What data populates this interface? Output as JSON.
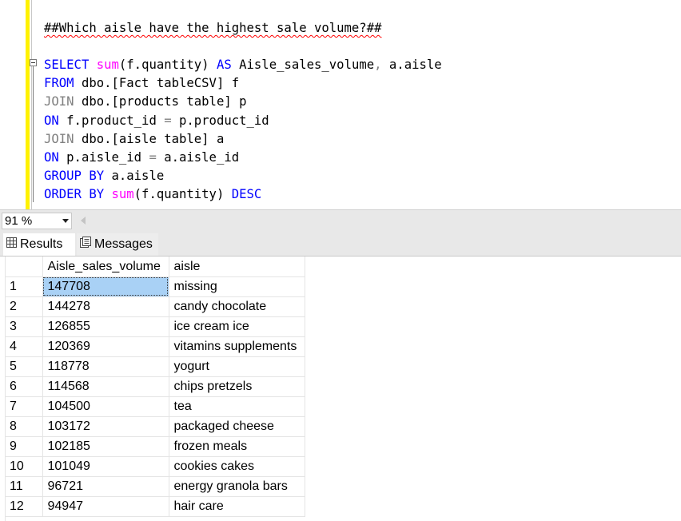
{
  "editor": {
    "comment": "##Which aisle have the highest sale volume?##",
    "lines": [
      {
        "a": "SELECT",
        "b": " ",
        "c": "sum",
        "d": "(f.quantity) ",
        "e": "AS",
        "f": " Aisle_sales_volume",
        "g": ",",
        "h": " a.aisle"
      },
      {
        "a": "FROM",
        "b": " dbo.[Fact tableCSV] f"
      },
      {
        "a": "JOIN",
        "b": " dbo.[products table] p"
      },
      {
        "a": "ON",
        "b": " f.product_id ",
        "c": "=",
        "d": " p.product_id"
      },
      {
        "a": "JOIN",
        "b": " dbo.[aisle table] a"
      },
      {
        "a": "ON",
        "b": " p.aisle_id ",
        "c": "=",
        "d": " a.aisle_id"
      },
      {
        "a": "GROUP BY",
        "b": " a.aisle"
      },
      {
        "a": "ORDER BY",
        "b": " ",
        "c": "sum",
        "d": "(f.quantity) ",
        "e": "DESC"
      }
    ]
  },
  "zoom": {
    "value": "91 %"
  },
  "tabs": {
    "results": "Results",
    "messages": "Messages"
  },
  "grid": {
    "columns": [
      "",
      "Aisle_sales_volume",
      "aisle"
    ],
    "rows": [
      [
        "1",
        "147708",
        "missing"
      ],
      [
        "2",
        "144278",
        "candy chocolate"
      ],
      [
        "3",
        "126855",
        "ice cream ice"
      ],
      [
        "4",
        "120369",
        "vitamins supplements"
      ],
      [
        "5",
        "118778",
        "yogurt"
      ],
      [
        "6",
        "114568",
        "chips pretzels"
      ],
      [
        "7",
        "104500",
        "tea"
      ],
      [
        "8",
        "103172",
        "packaged cheese"
      ],
      [
        "9",
        "102185",
        "frozen meals"
      ],
      [
        "10",
        "101049",
        "cookies cakes"
      ],
      [
        "11",
        "96721",
        "energy granola bars"
      ],
      [
        "12",
        "94947",
        "hair care"
      ]
    ]
  }
}
